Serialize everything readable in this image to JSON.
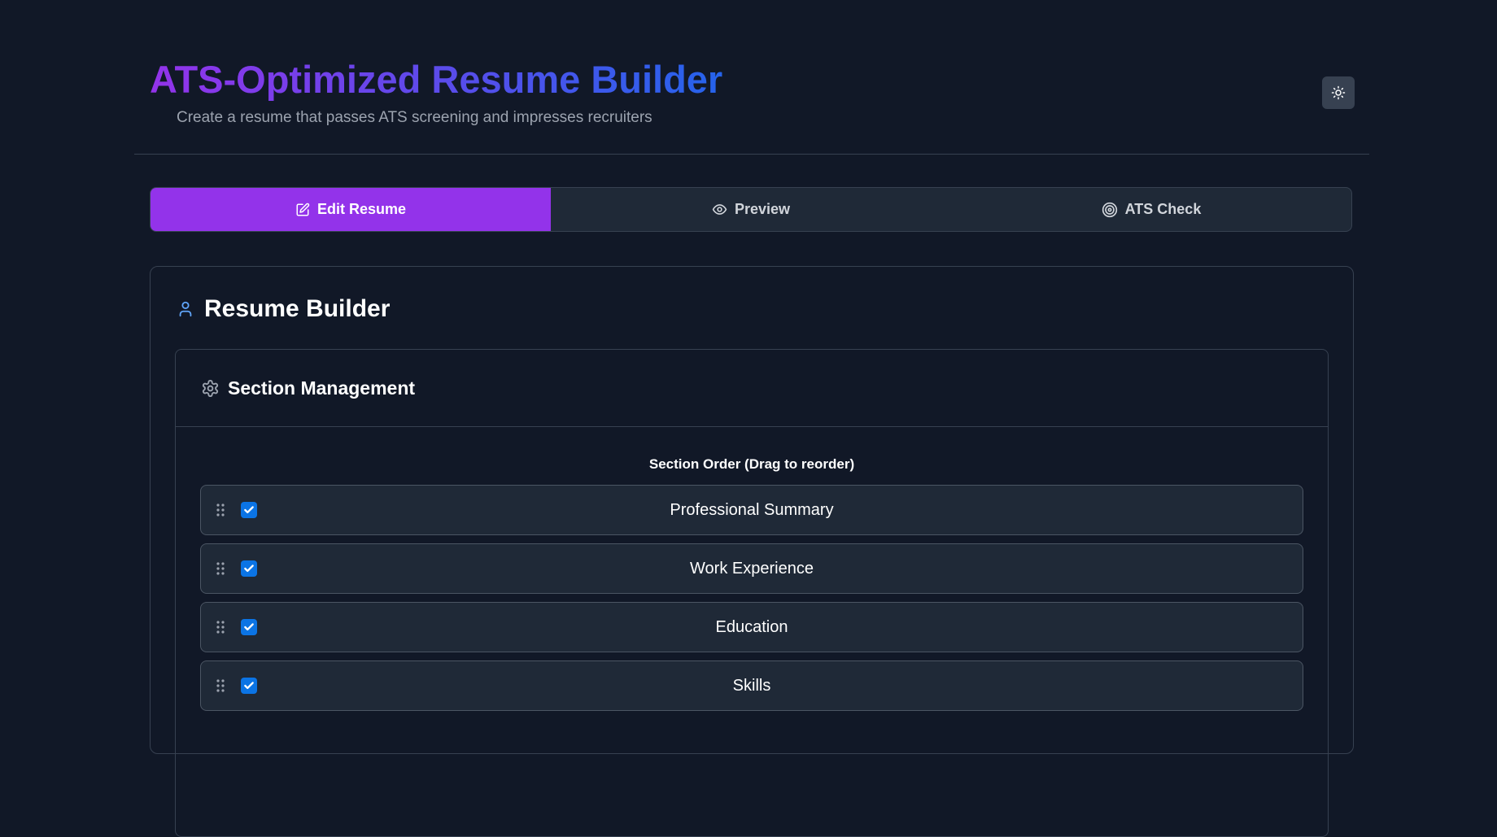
{
  "header": {
    "title": "ATS-Optimized Resume Builder",
    "subtitle": "Create a resume that passes ATS screening and impresses recruiters",
    "theme_toggle_icon": "sun-icon"
  },
  "tabs": [
    {
      "label": "Edit Resume",
      "icon": "edit-icon",
      "active": true
    },
    {
      "label": "Preview",
      "icon": "eye-icon",
      "active": false
    },
    {
      "label": "ATS Check",
      "icon": "target-icon",
      "active": false
    }
  ],
  "builder": {
    "title": "Resume Builder",
    "icon": "user-icon",
    "section_management": {
      "title": "Section Management",
      "icon": "gear-icon",
      "order_label": "Section Order (Drag to reorder)",
      "sections": [
        {
          "name": "Professional Summary",
          "checked": true
        },
        {
          "name": "Work Experience",
          "checked": true
        },
        {
          "name": "Education",
          "checked": true
        },
        {
          "name": "Skills",
          "checked": true
        }
      ]
    }
  },
  "colors": {
    "background": "#111827",
    "accent": "#9333ea",
    "gradient_end": "#2563eb",
    "checkbox": "#0b74e5"
  }
}
